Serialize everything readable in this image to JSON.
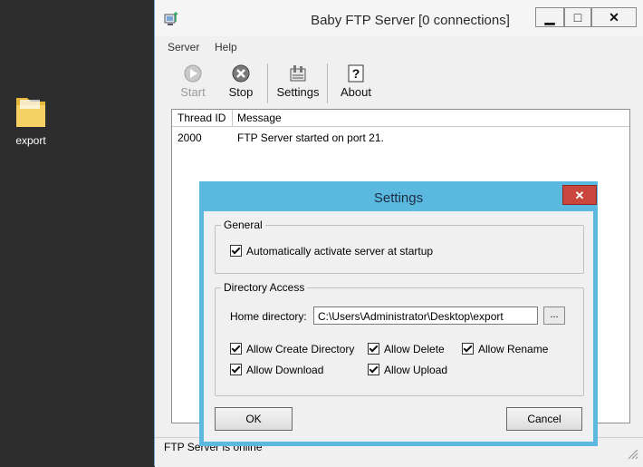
{
  "desktop": {
    "folder_label": "export"
  },
  "window": {
    "title": "Baby FTP Server [0 connections]",
    "controls": {
      "minimize": "▁",
      "maximize": "□",
      "close": "✕"
    }
  },
  "menu": {
    "items": [
      "Server",
      "Help"
    ]
  },
  "toolbar": {
    "start": "Start",
    "stop": "Stop",
    "settings": "Settings",
    "about": "About"
  },
  "log": {
    "columns": [
      "Thread ID",
      "Message"
    ],
    "rows": [
      {
        "thread_id": "2000",
        "message": "FTP Server started on port 21."
      }
    ]
  },
  "status_bar": {
    "text": "FTP Server is online"
  },
  "settings_dialog": {
    "title": "Settings",
    "close": "✕",
    "general": {
      "label": "General",
      "auto_activate": "Automatically activate server at startup"
    },
    "directory_access": {
      "label": "Directory Access",
      "home_label": "Home directory:",
      "home_value": "C:\\Users\\Administrator\\Desktop\\export",
      "browse": "...",
      "permissions": {
        "allow_create_directory": "Allow Create Directory",
        "allow_delete": "Allow Delete",
        "allow_rename": "Allow Rename",
        "allow_download": "Allow Download",
        "allow_upload": "Allow Upload"
      }
    },
    "ok": "OK",
    "cancel": "Cancel"
  },
  "colors": {
    "dialog_frame": "#5bb9e0",
    "close_red": "#c8463c",
    "desktop": "#2d2d2d"
  }
}
